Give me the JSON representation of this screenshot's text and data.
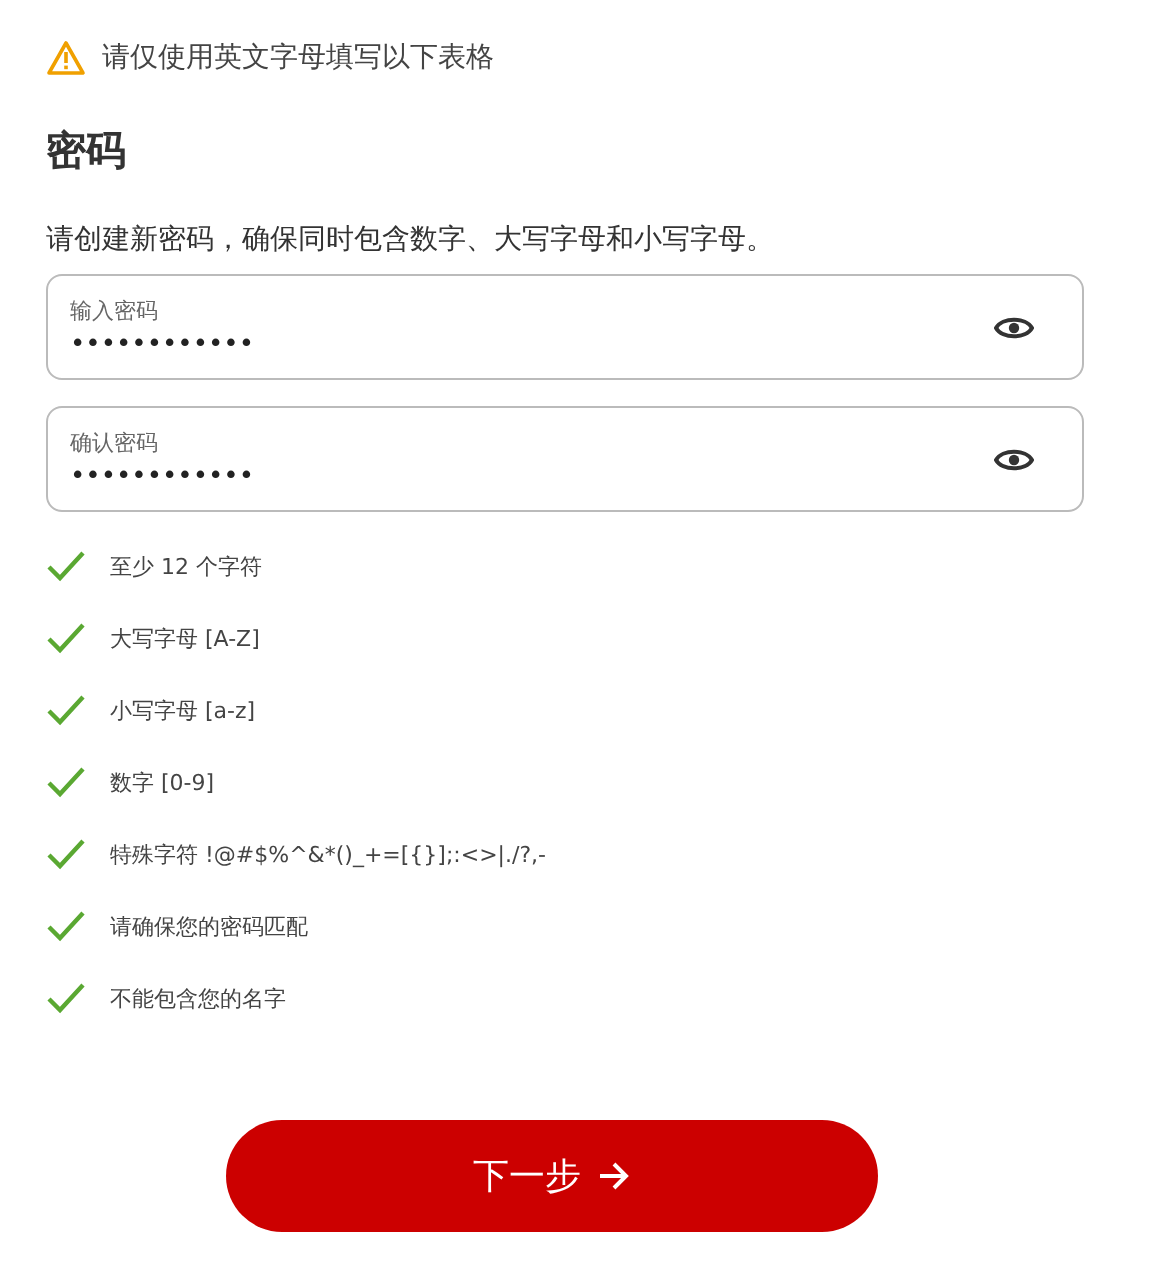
{
  "notice": "请仅使用英文字母填写以下表格",
  "heading": "密码",
  "instruction": "请创建新密码，确保同时包含数字、大写字母和小写字母。",
  "fields": [
    {
      "label": "输入密码",
      "value": "••••••••••••"
    },
    {
      "label": "确认密码",
      "value": "••••••••••••"
    }
  ],
  "requirements": [
    {
      "text": "至少 12 个字符",
      "met": true
    },
    {
      "text": "大写字母 [A-Z]",
      "met": true
    },
    {
      "text": "小写字母 [a-z]",
      "met": true
    },
    {
      "text": "数字 [0-9]",
      "met": true
    },
    {
      "text": "特殊字符 !@#$%^&*()_+=[{}];:<>|./?,-",
      "met": true
    },
    {
      "text": "请确保您的密码匹配",
      "met": true
    },
    {
      "text": "不能包含您的名字",
      "met": true
    }
  ],
  "next_button": "下一步"
}
